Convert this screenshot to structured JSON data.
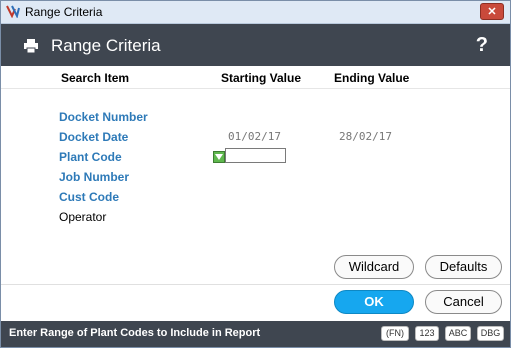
{
  "window": {
    "title": "Range Criteria",
    "close_glyph": "✕"
  },
  "header": {
    "title": "Range Criteria",
    "help_glyph": "?"
  },
  "columns": {
    "search_item": "Search Item",
    "starting_value": "Starting Value",
    "ending_value": "Ending Value"
  },
  "rows": [
    {
      "label": "Docket Number",
      "start": "",
      "end": ""
    },
    {
      "label": "Docket Date",
      "start": "01/02/17",
      "end": "28/02/17"
    },
    {
      "label": "Plant Code",
      "start": "",
      "end": ""
    },
    {
      "label": "Job Number",
      "start": "",
      "end": ""
    },
    {
      "label": "Cust Code",
      "start": "",
      "end": ""
    },
    {
      "label": "Operator",
      "start": "",
      "end": ""
    }
  ],
  "buttons": {
    "wildcard": "Wildcard",
    "defaults": "Defaults",
    "ok": "OK",
    "cancel": "Cancel"
  },
  "status": {
    "message": "Enter Range of Plant Codes to Include in Report",
    "indicators": [
      "(FN)",
      "123",
      "ABC",
      "DBG"
    ]
  },
  "icons": {
    "app": "app-logo-icon",
    "print": "printer-icon",
    "help": "help-icon",
    "plant_flag": "green-flag-icon"
  },
  "colors": {
    "header_bg": "#3f4650",
    "label_blue": "#2e7ab8",
    "ok_blue": "#16a7ef"
  }
}
